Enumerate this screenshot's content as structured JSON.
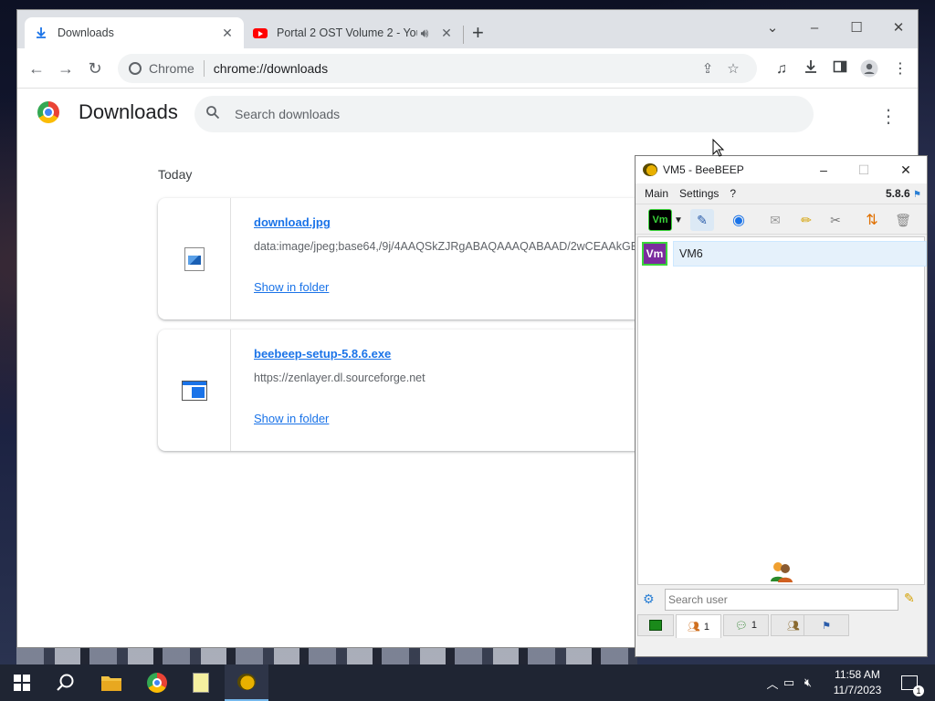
{
  "chrome": {
    "tabs": [
      {
        "title": "Downloads",
        "active": true
      },
      {
        "title": "Portal 2 OST Volume 2 - You",
        "active": false
      }
    ],
    "new_tab": "+",
    "window_controls": {
      "minimize": "–",
      "maximize": "☐",
      "close": "✕",
      "tab_search": "⌄"
    },
    "omnibox": {
      "site_label": "Chrome",
      "url": "chrome://downloads"
    }
  },
  "downloads": {
    "title": "Downloads",
    "search_placeholder": "Search downloads",
    "section": "Today",
    "items": [
      {
        "filename": "download.jpg",
        "url": "data:image/jpeg;base64,/9j/4AAQSkZJRgABAQAAAQABAAD/2wCEAAkGB",
        "action": "Show in folder",
        "icon": "image-file-icon"
      },
      {
        "filename": "beebeep-setup-5.8.6.exe",
        "url": "https://zenlayer.dl.sourceforge.net",
        "action": "Show in folder",
        "icon": "exe-file-icon"
      }
    ]
  },
  "beebeep": {
    "title": "VM5 - BeeBEEP",
    "menu": [
      "Main",
      "Settings",
      "?"
    ],
    "version": "5.8.6",
    "users": [
      {
        "avatar": "Vm",
        "name": "VM6",
        "status_color": "#3ad53a"
      }
    ],
    "search_placeholder": "Search user",
    "tabs": [
      {
        "icon": "status-icon",
        "count": ""
      },
      {
        "icon": "users-icon",
        "count": "1"
      },
      {
        "icon": "chat-icon",
        "count": "1"
      },
      {
        "icon": "groups-icon",
        "count": ""
      },
      {
        "icon": "share-icon",
        "count": ""
      }
    ]
  },
  "taskbar": {
    "time": "11:58 AM",
    "date": "11/7/2023",
    "notification_count": "1",
    "apps": [
      "start",
      "search",
      "file-explorer",
      "chrome",
      "notepad",
      "beebeep"
    ]
  },
  "colors": {
    "accent": "#1a73e8",
    "taskbar": "#1f2533",
    "beebeep_avatar": "#7b2c9e"
  }
}
